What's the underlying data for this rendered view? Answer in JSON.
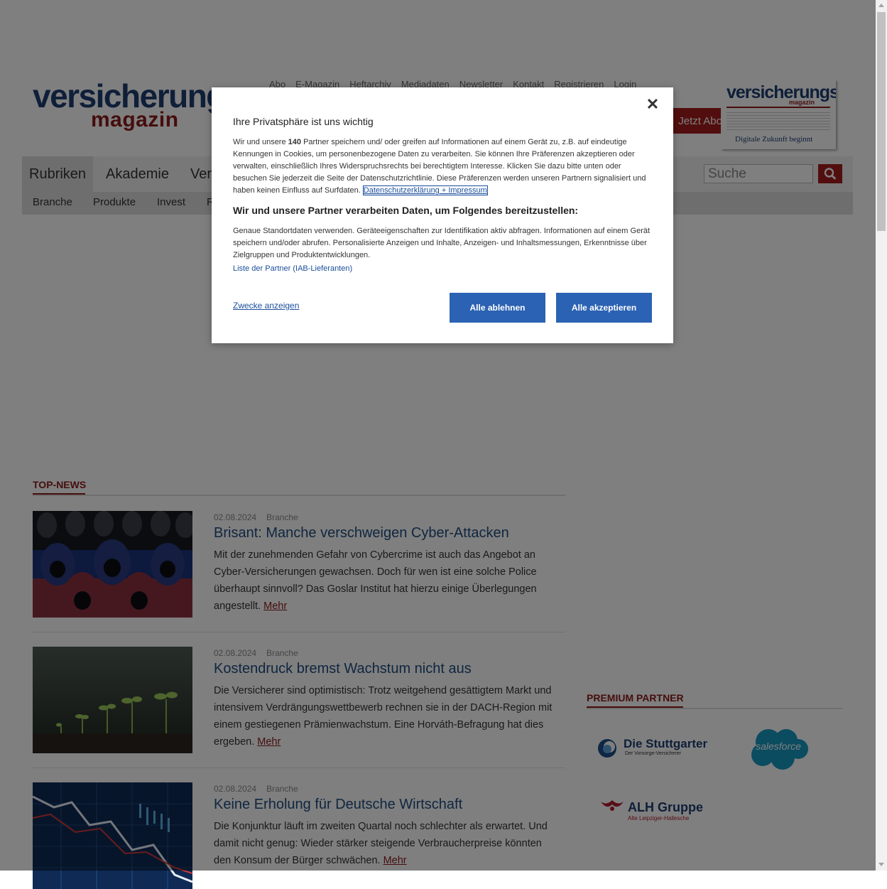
{
  "header": {
    "logo_line1": "versicherungs",
    "logo_line2": "magazin",
    "topnav": [
      "Abo",
      "E-Magazin",
      "Heftarchiv",
      "Mediadaten",
      "Newsletter",
      "Kontakt",
      "Registrieren",
      "Login"
    ],
    "abo_button": "Jetzt Abo testen",
    "cover_title": "versicherungs",
    "cover_sub": "magazin",
    "cover_headline": "Digitale Zukunft beginnt"
  },
  "mainnav": {
    "items": [
      "Rubriken",
      "Akademie",
      "Ver"
    ],
    "search_placeholder": "Suche"
  },
  "subnav": {
    "items": [
      "Branche",
      "Produkte",
      "Invest",
      "R"
    ]
  },
  "topnews": {
    "title": "TOP-NEWS",
    "articles": [
      {
        "date": "02.08.2024",
        "category": "Branche",
        "headline": "Brisant: Manche verschweigen Cyber-Attacken",
        "teaser": "Mit der zunehmenden Gefahr von Cybercrime ist auch das Angebot an Cyber-Versicherungen gewachsen. Doch für wen ist eine solche Police überhaupt sinnvoll? Das Goslar Institut hat hierzu einige Überlegungen angestellt.",
        "more": "Mehr"
      },
      {
        "date": "02.08.2024",
        "category": "Branche",
        "headline": "Kostendruck bremst Wachstum nicht aus",
        "teaser": "Die Versicherer sind optimistisch: Trotz weitgehend gesättigtem Markt und intensivem Verdrängungswettbewerb rechnen sie in der DACH-Region mit einem gestiegenen Prämienwachstum. Eine Horváth-Befragung hat dies ergeben.",
        "more": "Mehr"
      },
      {
        "date": "02.08.2024",
        "category": "Branche",
        "headline": "Keine Erholung für Deutsche Wirtschaft",
        "teaser": "Die Konjunktur läuft im zweiten Quartal noch schlechter als erwartet. Und damit nicht genug: Wieder stärker steigende Verbraucherpreise könnten den Konsum der Bürger schwächen.",
        "more": "Mehr"
      }
    ]
  },
  "premium": {
    "title": "PREMIUM PARTNER",
    "stuttgarter": "Die Stuttgarter",
    "stuttgarter_sub": "Der Vorsorge-Versicherer",
    "salesforce": "salesforce",
    "alh": "ALH Gruppe",
    "alh_sub": "Alte Leipziger-Hallesche"
  },
  "consent": {
    "title": "Ihre Privatsphäre ist uns wichtig",
    "p1_a": "Wir und unsere ",
    "p1_count": "140",
    "p1_b": " Partner speichern und/ oder greifen auf Informationen auf einem Gerät zu, z.B. auf eindeutige Kennungen in Cookies, um personenbezogene Daten zu verarbeiten. Sie können Ihre Präferenzen akzeptieren oder verwalten, einschließlich Ihres Widerspruchsrechts bei berechtigtem Interesse. Klicken Sie dazu bitte unten oder besuchen Sie jederzeit die Seite der Datenschutzrichtlinie. Diese Präferenzen werden unseren Partnern signalisiert und haben keinen Einfluss auf Surfdaten.",
    "privacy_link": "Datenschutzerklärung + Impressum",
    "subtitle": "Wir und unsere Partner verarbeiten Daten, um Folgendes bereitzustellen:",
    "p2": "Genaue Standortdaten verwenden. Geräteeigenschaften zur Identifikation aktiv abfragen. Informationen auf einem Gerät speichern und/oder abrufen. Personalisierte Anzeigen und Inhalte, Anzeigen- und Inhaltsmessungen, Erkenntnisse über Zielgruppen und Produktentwicklungen.",
    "partner_list": "Liste der Partner (IAB-Lieferanten)",
    "purposes": "Zwecke anzeigen",
    "reject": "Alle ablehnen",
    "accept": "Alle akzeptieren",
    "close": "✕"
  },
  "colors": {
    "brand_blue": "#1f3f73",
    "brand_red": "#8d1b1b",
    "button_blue": "#2b62b3"
  }
}
